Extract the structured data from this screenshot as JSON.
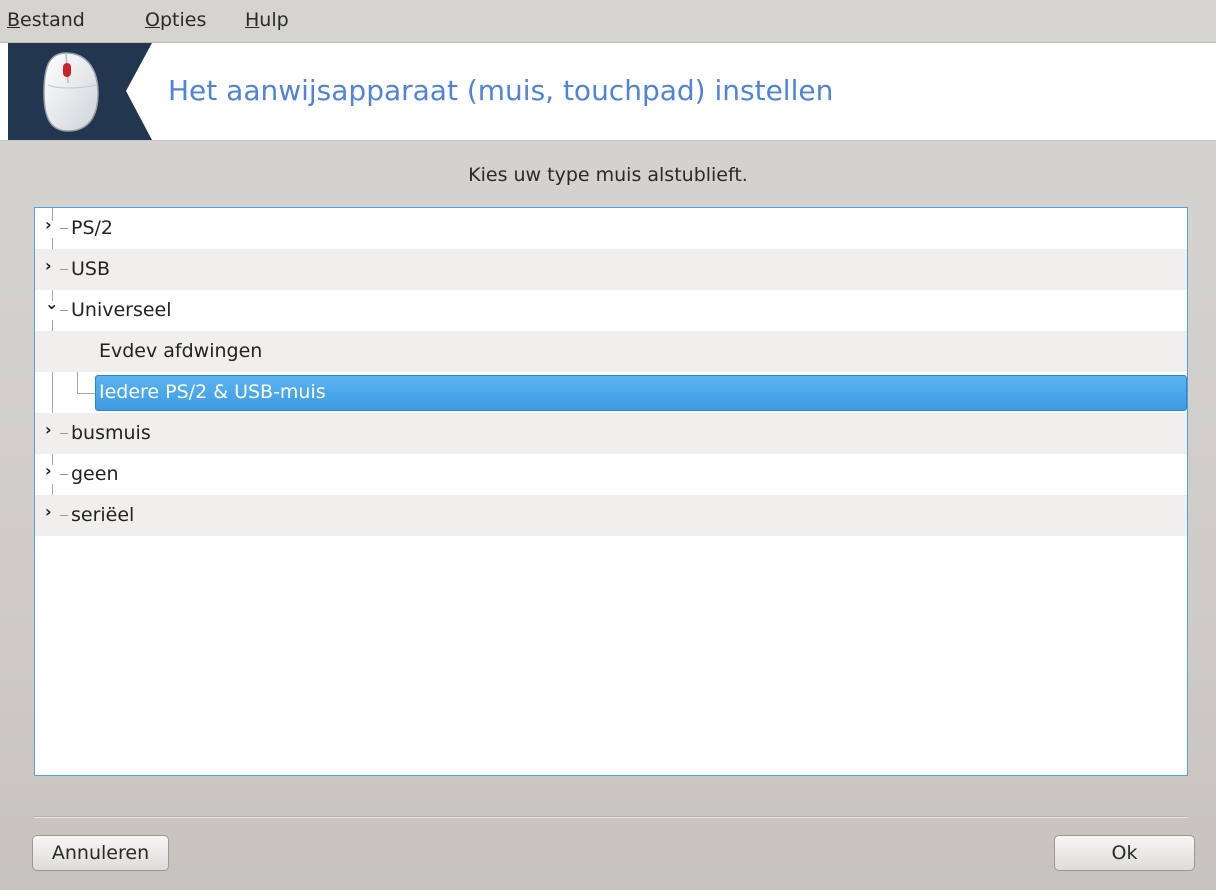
{
  "menubar": {
    "items": [
      {
        "accel": "B",
        "rest": "estand"
      },
      {
        "accel": "O",
        "rest": "pties"
      },
      {
        "accel": "H",
        "rest": "ulp"
      }
    ]
  },
  "banner": {
    "title": "Het aanwijsapparaat (muis, touchpad) instellen",
    "icon": "mouse-icon",
    "background_color": "#22364f",
    "title_color": "#5183d6"
  },
  "instruction": "Kies uw type muis alstublieft.",
  "tree": {
    "items": [
      {
        "label": "PS/2",
        "expanded": false
      },
      {
        "label": "USB",
        "expanded": false
      },
      {
        "label": "Universeel",
        "expanded": true
      },
      {
        "label": "Evdev afdwingen",
        "child": true
      },
      {
        "label": "Iedere PS/2 & USB-muis",
        "child": true,
        "selected": true
      },
      {
        "label": "busmuis",
        "expanded": false
      },
      {
        "label": "geen",
        "expanded": false
      },
      {
        "label": "seriëel",
        "expanded": false
      }
    ],
    "selection_color": "#3d9be3"
  },
  "buttons": {
    "cancel": "Annuleren",
    "ok": "Ok"
  }
}
